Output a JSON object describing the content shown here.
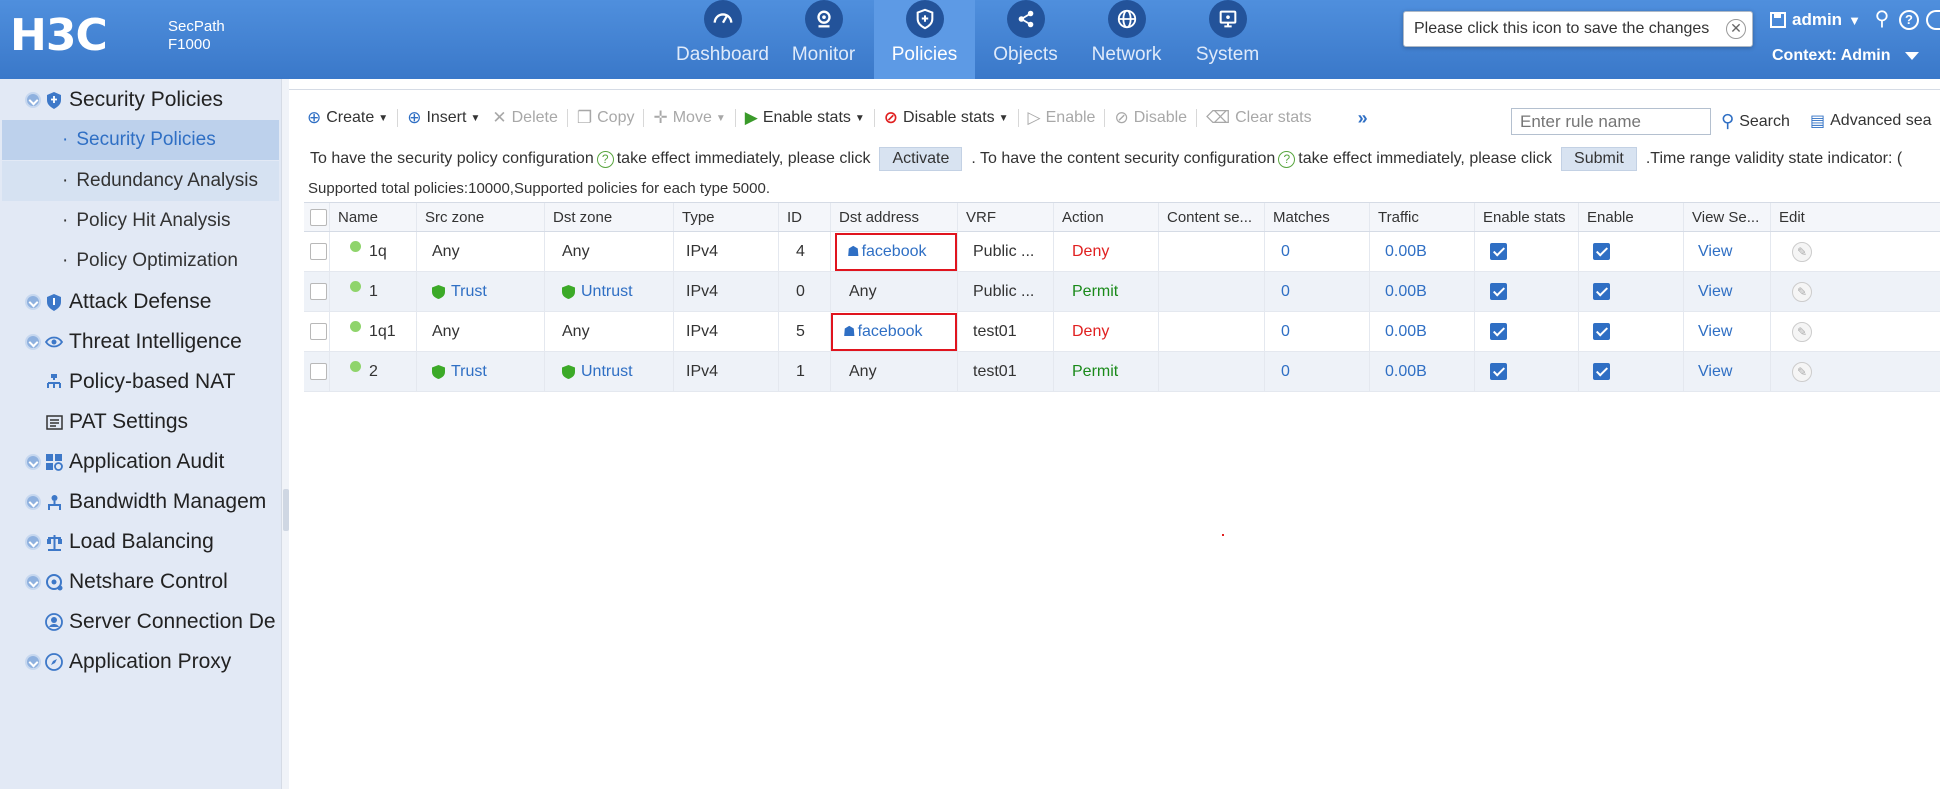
{
  "header": {
    "brand": "H3C",
    "product_line1": "SecPath",
    "product_line2": "F1000",
    "nav": [
      {
        "label": "Dashboard",
        "icon": "gauge-icon"
      },
      {
        "label": "Monitor",
        "icon": "monitor-icon"
      },
      {
        "label": "Policies",
        "icon": "shield-icon",
        "active": true
      },
      {
        "label": "Objects",
        "icon": "share-nodes-icon"
      },
      {
        "label": "Network",
        "icon": "globe-icon"
      },
      {
        "label": "System",
        "icon": "system-screen-icon"
      }
    ],
    "tooltip": "Please click this icon to save the changes",
    "user": "admin",
    "context": "Context: Admin"
  },
  "sidebar": {
    "items": [
      {
        "label": "Security Policies",
        "expandable": true,
        "icon": "shield-icon"
      },
      {
        "label": "Attack Defense",
        "expandable": true,
        "icon": "shield-icon"
      },
      {
        "label": "Threat Intelligence",
        "expandable": true,
        "icon": "eye-icon"
      },
      {
        "label": "Policy-based NAT",
        "expandable": false,
        "icon": "nat-icon"
      },
      {
        "label": "PAT Settings",
        "expandable": false,
        "icon": "list-icon"
      },
      {
        "label": "Application Audit",
        "expandable": true,
        "icon": "grid-icon"
      },
      {
        "label": "Bandwidth Managem",
        "expandable": true,
        "icon": "people-icon"
      },
      {
        "label": "Load Balancing",
        "expandable": true,
        "icon": "balance-icon"
      },
      {
        "label": "Netshare Control",
        "expandable": true,
        "icon": "share-icon"
      },
      {
        "label": "Server Connection De",
        "expandable": false,
        "icon": "server-icon"
      },
      {
        "label": "Application Proxy",
        "expandable": true,
        "icon": "compass-icon"
      }
    ],
    "subitems": [
      {
        "label": "Security Policies",
        "active": true
      },
      {
        "label": "Redundancy Analysis"
      },
      {
        "label": "Policy Hit Analysis"
      },
      {
        "label": "Policy Optimization"
      }
    ]
  },
  "toolbar": {
    "create": "Create",
    "insert": "Insert",
    "delete": "Delete",
    "copy": "Copy",
    "move": "Move",
    "enable_stats": "Enable stats",
    "disable_stats": "Disable stats",
    "enable": "Enable",
    "disable": "Disable",
    "clear_stats": "Clear stats",
    "more": "»",
    "search_placeholder": "Enter rule name",
    "search": "Search",
    "advanced_search": "Advanced sea"
  },
  "hint": {
    "part1": "To have the security policy configuration",
    "part2": "take effect immediately, please click",
    "activate": "Activate",
    "part3": ". To have the content security configuration",
    "part4": "take effect immediately, please click",
    "submit": "Submit",
    "part5": ".Time range validity state indicator: ("
  },
  "support_text": "Supported total policies:10000,Supported policies for each type 5000.",
  "table": {
    "columns": [
      "Name",
      "Src zone",
      "Dst zone",
      "Type",
      "ID",
      "Dst address",
      "VRF",
      "Action",
      "Content se...",
      "Matches",
      "Traffic",
      "Enable stats",
      "Enable",
      "View Se...",
      "Edit"
    ],
    "rows": [
      {
        "name": "1q",
        "src": "Any",
        "dst": "Any",
        "type": "IPv4",
        "id": "4",
        "dst_address": "facebook",
        "vrf": "Public ...",
        "action": "Deny",
        "content": "",
        "matches": "0",
        "traffic": "0.00B",
        "view": "View"
      },
      {
        "name": "1",
        "src": "Trust",
        "dst": "Untrust",
        "type": "IPv4",
        "id": "0",
        "dst_address": "Any",
        "vrf": "Public ...",
        "action": "Permit",
        "content": "",
        "matches": "0",
        "traffic": "0.00B",
        "view": "View"
      },
      {
        "name": "1q1",
        "src": "Any",
        "dst": "Any",
        "type": "IPv4",
        "id": "5",
        "dst_address": "facebook",
        "vrf": "test01",
        "action": "Deny",
        "content": "",
        "matches": "0",
        "traffic": "0.00B",
        "view": "View"
      },
      {
        "name": "2",
        "src": "Trust",
        "dst": "Untrust",
        "type": "IPv4",
        "id": "1",
        "dst_address": "Any",
        "vrf": "test01",
        "action": "Permit",
        "content": "",
        "matches": "0",
        "traffic": "0.00B",
        "view": "View"
      }
    ]
  },
  "colors": {
    "header": "#3f7fd0",
    "active_tab": "#5d9ae5",
    "sidebar": "#e2e9f5",
    "link": "#2f6fc4",
    "deny": "#e02020",
    "permit": "#1a8a1a",
    "highlight_box": "#e0141e"
  }
}
